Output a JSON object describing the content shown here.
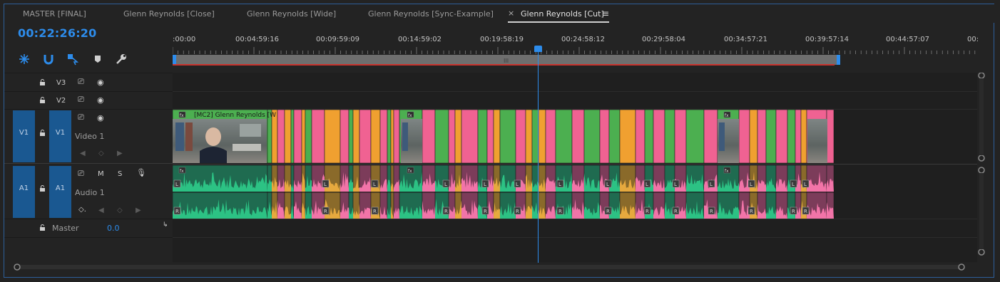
{
  "tabs": [
    {
      "label": "MASTER [FINAL]"
    },
    {
      "label": "Glenn Reynolds [Close]"
    },
    {
      "label": "Glenn Reynolds [Wide]"
    },
    {
      "label": "Glenn Reynolds [Sync-Example]"
    },
    {
      "label": "Glenn Reynolds [Cut]"
    }
  ],
  "timecode": "00:22:26:20",
  "ruler": {
    "labels": [
      ":00:00",
      "00:04:59:16",
      "00:09:59:09",
      "00:14:59:02",
      "00:19:58:19",
      "00:24:58:12",
      "00:29:58:04",
      "00:34:57:21",
      "00:39:57:14",
      "00:44:57:07",
      "00:"
    ]
  },
  "tracks": {
    "v3": {
      "name": "V3"
    },
    "v2": {
      "name": "V2"
    },
    "v1": {
      "target": "V1",
      "name": "V1",
      "label": "Video 1"
    },
    "a1": {
      "target": "A1",
      "name": "A1",
      "label": "Audio 1",
      "mute": "M",
      "solo": "S"
    },
    "master": {
      "label": "Master",
      "value": "0.0"
    }
  },
  "clips": {
    "v1_first_label": "[MC2] Glenn Reynolds [W",
    "fx_badge": "fx",
    "audio_left": "L",
    "audio_right": "R"
  },
  "colors": {
    "accent": "#2d8ceb",
    "clip_green": "#4caf50",
    "clip_pink": "#f06292",
    "clip_orange": "#f0a030",
    "audio_green": "#2ecc8a",
    "track_target": "#1a5891"
  }
}
